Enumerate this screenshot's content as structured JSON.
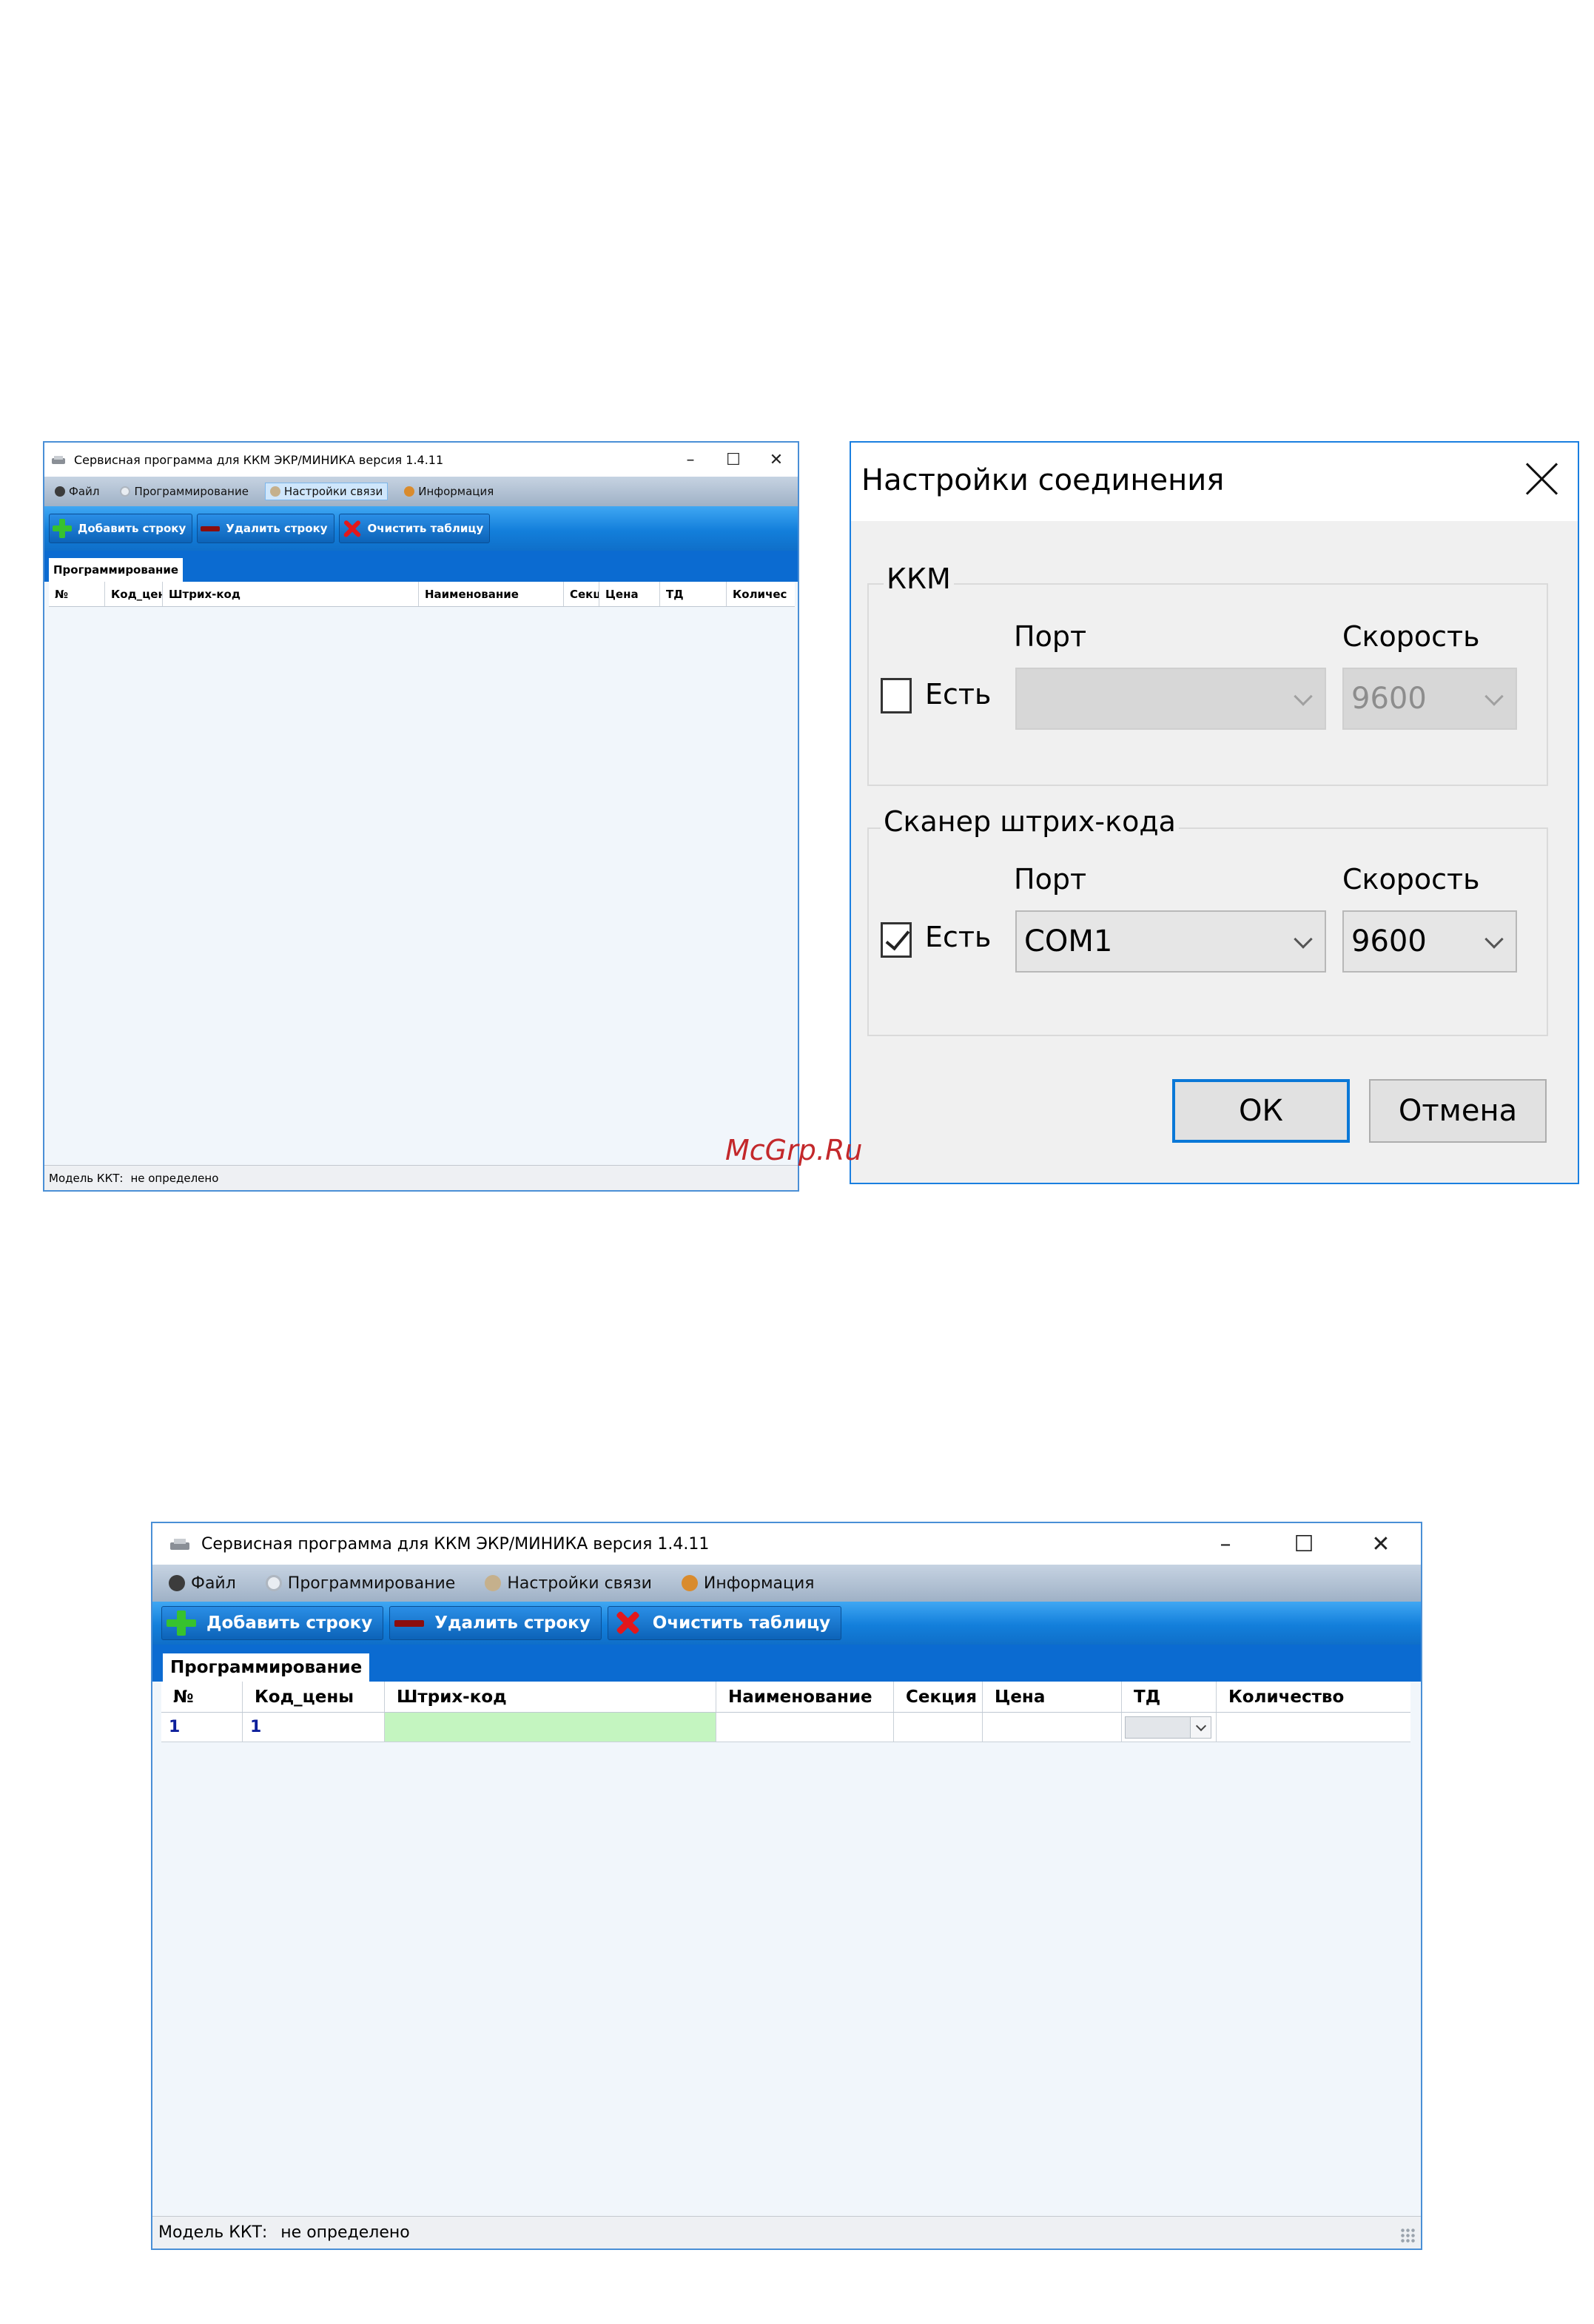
{
  "small_window": {
    "title": "Сервисная программа для ККМ ЭКР/МИНИКА версия 1.4.11",
    "controls": {
      "minimize": "–",
      "maximize": "☐",
      "close": "✕"
    },
    "menu": [
      {
        "label": "Файл",
        "icon": "file-icon"
      },
      {
        "label": "Программирование",
        "icon": "programming-icon"
      },
      {
        "label": "Настройки связи",
        "icon": "connection-settings-icon",
        "active": true
      },
      {
        "label": "Информация",
        "icon": "info-icon"
      }
    ],
    "toolbar": {
      "add_row": "Добавить строку",
      "delete_row": "Удалить строку",
      "clear_table": "Очистить таблицу"
    },
    "tab": "Программирование",
    "columns": [
      "№",
      "Код_цен",
      "Штрих-код",
      "Наименование",
      "Секц",
      "Цена",
      "ТД",
      "Количес"
    ],
    "status": {
      "label": "Модель ККТ:",
      "value": "не определено"
    }
  },
  "dialog": {
    "title": "Настройки соединения",
    "kkm": {
      "group_label": "ККМ",
      "checkbox_label": "Есть",
      "checked": false,
      "port_label": "Порт",
      "port_value": "",
      "speed_label": "Скорость",
      "speed_value": "9600"
    },
    "scanner": {
      "group_label": "Сканер штрих-кода",
      "checkbox_label": "Есть",
      "checked": true,
      "port_label": "Порт",
      "port_value": "COM1",
      "speed_label": "Скорость",
      "speed_value": "9600"
    },
    "ok_label": "ОК",
    "cancel_label": "Отмена"
  },
  "watermark": "McGrp.Ru",
  "large_window": {
    "title": "Сервисная программа для ККМ ЭКР/МИНИКА версия 1.4.11",
    "controls": {
      "minimize": "–",
      "maximize": "☐",
      "close": "✕"
    },
    "menu": [
      {
        "label": "Файл",
        "icon": "file-icon"
      },
      {
        "label": "Программирование",
        "icon": "programming-icon"
      },
      {
        "label": "Настройки связи",
        "icon": "connection-settings-icon"
      },
      {
        "label": "Информация",
        "icon": "info-icon"
      }
    ],
    "toolbar": {
      "add_row": "Добавить строку",
      "delete_row": "Удалить строку",
      "clear_table": "Очистить таблицу"
    },
    "tab": "Программирование",
    "columns": [
      "№",
      "Код_цены",
      "Штрих-код",
      "Наименование",
      "Секция",
      "Цена",
      "ТД",
      "Количество"
    ],
    "rows": [
      {
        "num": "1",
        "price_code": "1",
        "barcode": "",
        "name": "",
        "section": "",
        "price": "",
        "td": "",
        "quantity": ""
      }
    ],
    "status": {
      "label": "Модель ККТ:",
      "value": "не определено"
    }
  }
}
